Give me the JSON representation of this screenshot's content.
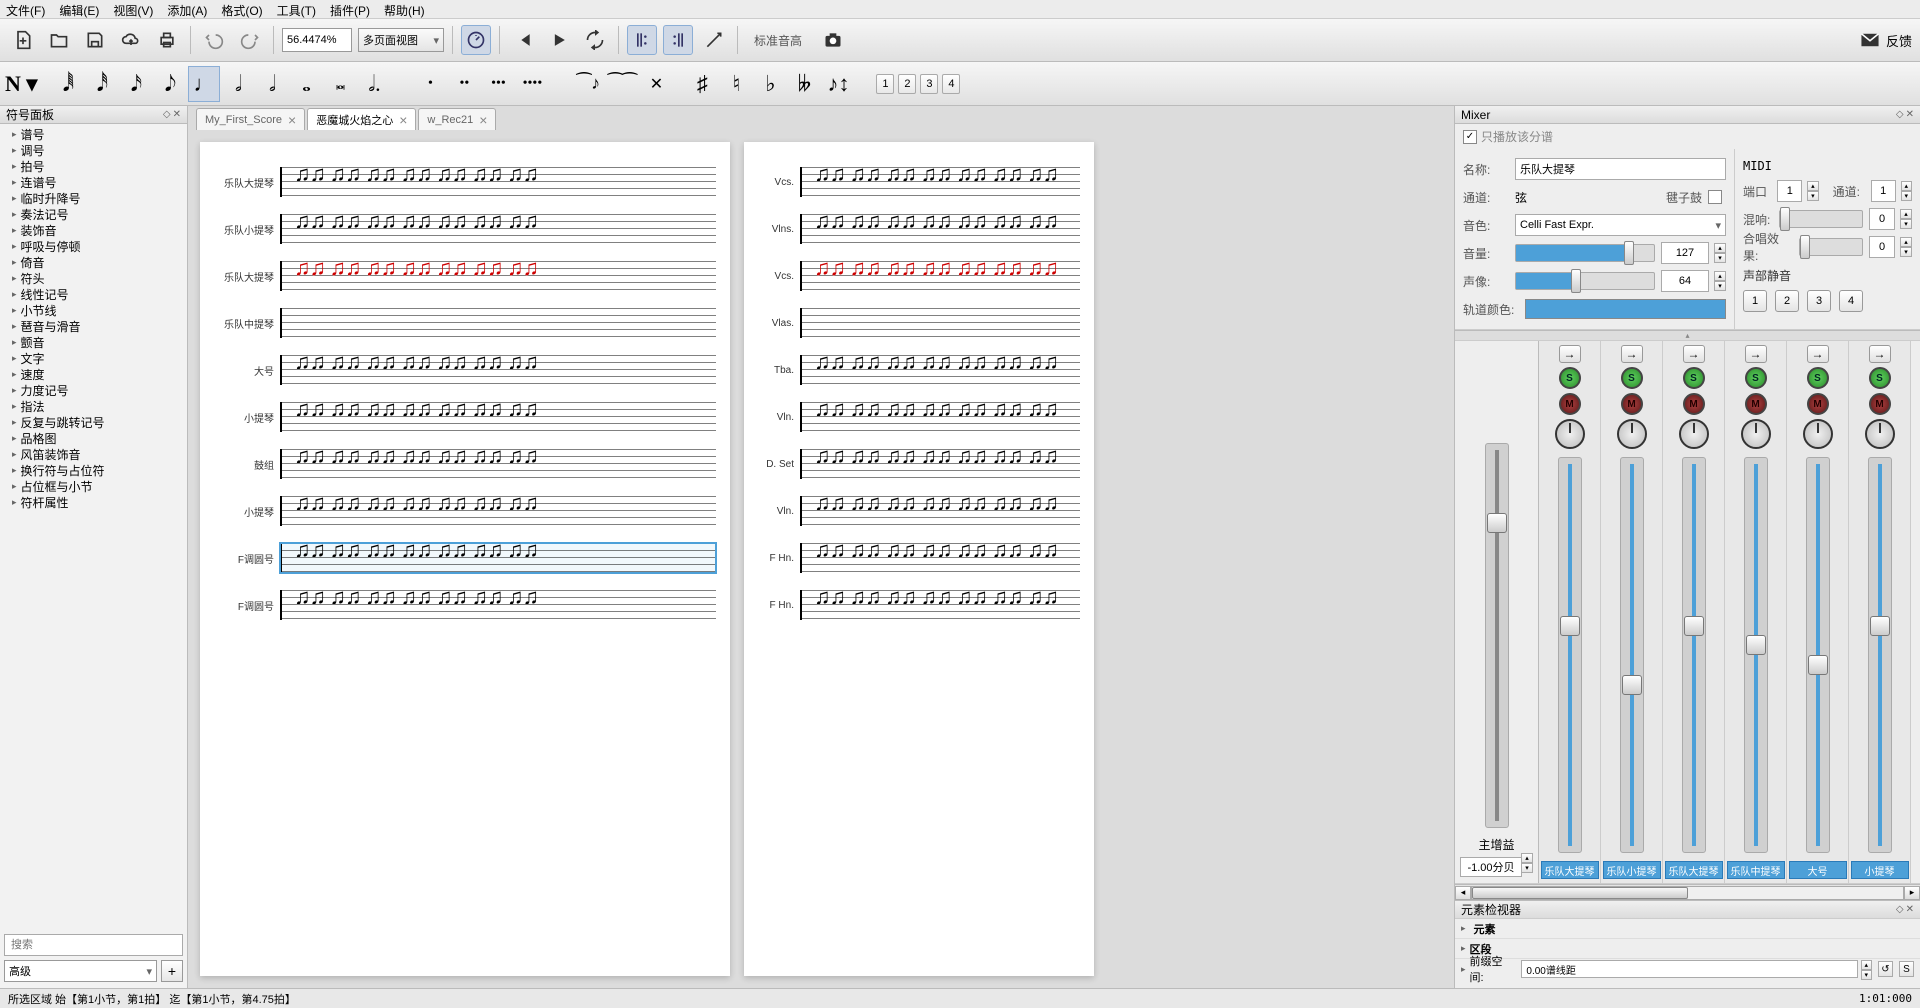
{
  "menu": [
    "文件(F)",
    "编辑(E)",
    "视图(V)",
    "添加(A)",
    "格式(O)",
    "工具(T)",
    "插件(P)",
    "帮助(H)"
  ],
  "toolbar": {
    "zoom": "56.4474%",
    "view_mode": "多页面视图",
    "pitch_label": "标准音高",
    "feedback": "反馈"
  },
  "voices": [
    "1",
    "2",
    "3",
    "4"
  ],
  "palette": {
    "title": "符号面板",
    "items": [
      "谱号",
      "调号",
      "拍号",
      "连谱号",
      "临时升降号",
      "奏法记号",
      "装饰音",
      "呼吸与停顿",
      "倚音",
      "符头",
      "线性记号",
      "小节线",
      "琶音与滑音",
      "颤音",
      "文字",
      "速度",
      "力度记号",
      "指法",
      "反复与跳转记号",
      "品格图",
      "风笛装饰音",
      "换行符与占位符",
      "占位框与小节",
      "符杆属性"
    ],
    "search_placeholder": "搜索",
    "level": "高级"
  },
  "tabs": [
    {
      "label": "My_First_Score",
      "active": false
    },
    {
      "label": "恶魔城火焰之心",
      "active": true
    },
    {
      "label": "w_Rec21",
      "active": false
    }
  ],
  "score": {
    "left_instruments": [
      "乐队大提琴",
      "乐队小提琴",
      "乐队大提琴",
      "乐队中提琴",
      "大号",
      "小提琴",
      "鼓组",
      "小提琴",
      "F调圆号",
      "F调圆号"
    ],
    "right_instruments": [
      "Vcs.",
      "Vlns.",
      "Vcs.",
      "Vlas.",
      "Tba.",
      "Vln.",
      "D. Set",
      "Vln.",
      "F Hn.",
      "F Hn."
    ],
    "selected_staff_index_left": 8
  },
  "mixer": {
    "title": "Mixer",
    "play_only_checkbox": "只播放该分谱",
    "name_label": "名称:",
    "name_value": "乐队大提琴",
    "channel_label": "通道:",
    "channel_value": "弦",
    "drum_label": "毽子鼓",
    "sound_label": "音色:",
    "sound_value": "Celli Fast Expr.",
    "vol_label": "音量:",
    "vol_val": "127",
    "vol_pct": 80,
    "pan_label": "声像:",
    "pan_val": "64",
    "pan_pct": 42,
    "color_label": "轨道颜色:",
    "color_value": "#4da0d8",
    "midi_title": "MIDI",
    "port_label": "端口",
    "port_val": "1",
    "midi_channel_label": "通道:",
    "midi_channel_val": "1",
    "reverb_label": "混响:",
    "reverb_val": "0",
    "chorus_label": "合唱效果:",
    "chorus_val": "0",
    "mute_title": "声部静音",
    "mute_btns": [
      "1",
      "2",
      "3",
      "4"
    ],
    "master_label": "主增益",
    "master_gain": "-1.00分贝",
    "strips": [
      {
        "name": "乐队大提琴",
        "fader": 40
      },
      {
        "name": "乐队小提琴",
        "fader": 55
      },
      {
        "name": "乐队大提琴",
        "fader": 40
      },
      {
        "name": "乐队中提琴",
        "fader": 45
      },
      {
        "name": "大号",
        "fader": 50
      },
      {
        "name": "小提琴",
        "fader": 40
      }
    ]
  },
  "inspector": {
    "title": "元素检视器",
    "sections": [
      "元素",
      "区段"
    ],
    "leading_label": "前缀空间:",
    "leading_value": "0.00谱线距"
  },
  "status": {
    "text": "所选区域 始【第1小节，第1拍】 迄【第1小节，第4.75拍】",
    "time": "1:01:000"
  }
}
